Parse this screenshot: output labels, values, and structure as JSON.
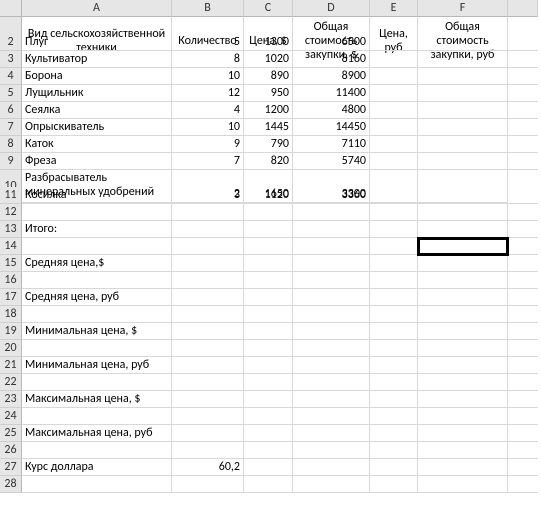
{
  "columns": [
    "A",
    "B",
    "C",
    "D",
    "E",
    "F"
  ],
  "header_row": {
    "A": "Вид сельскохозяйственной техники",
    "B": "Количество",
    "C": "Цена, $",
    "D": "Общая стоимость закупки, $",
    "E": "Цена, руб",
    "F": "Общая стоимость закупки, руб"
  },
  "rows": [
    {
      "n": 2,
      "A": "Плуг",
      "B": "5",
      "C": "1300",
      "D": "6500"
    },
    {
      "n": 3,
      "A": "Культиватор",
      "B": "8",
      "C": "1020",
      "D": "8160"
    },
    {
      "n": 4,
      "A": "Борона",
      "B": "10",
      "C": "890",
      "D": "8900"
    },
    {
      "n": 5,
      "A": "Лущильник",
      "B": "12",
      "C": "950",
      "D": "11400"
    },
    {
      "n": 6,
      "A": "Сеялка",
      "B": "4",
      "C": "1200",
      "D": "4800"
    },
    {
      "n": 7,
      "A": "Опрыскиватель",
      "B": "10",
      "C": "1445",
      "D": "14450"
    },
    {
      "n": 8,
      "A": "Каток",
      "B": "9",
      "C": "790",
      "D": "7110"
    },
    {
      "n": 9,
      "A": "Фреза",
      "B": "7",
      "C": "820",
      "D": "5740"
    },
    {
      "n": 10,
      "A": "Разбрасыватель минеральных удобрений",
      "B": "2",
      "C": "1650",
      "D": "3300",
      "tall": true
    },
    {
      "n": 11,
      "A": "Косилка",
      "B": "3",
      "C": "1120",
      "D": "3360"
    },
    {
      "n": 12
    },
    {
      "n": 13,
      "A": "Итого:"
    },
    {
      "n": 14
    },
    {
      "n": 15,
      "A": "Средняя цена,$"
    },
    {
      "n": 16
    },
    {
      "n": 17,
      "A": "Средняя цена, руб"
    },
    {
      "n": 18
    },
    {
      "n": 19,
      "A": "Минимальная цена, $"
    },
    {
      "n": 20
    },
    {
      "n": 21,
      "A": "Минимальная цена, руб"
    },
    {
      "n": 22
    },
    {
      "n": 23,
      "A": "Максимальная цена, $"
    },
    {
      "n": 24
    },
    {
      "n": 25,
      "A": "Максимальная цена, руб"
    },
    {
      "n": 26
    },
    {
      "n": 27,
      "A": "Курс доллара",
      "B": "60,2"
    },
    {
      "n": 28
    }
  ],
  "selected_cell": "F14"
}
